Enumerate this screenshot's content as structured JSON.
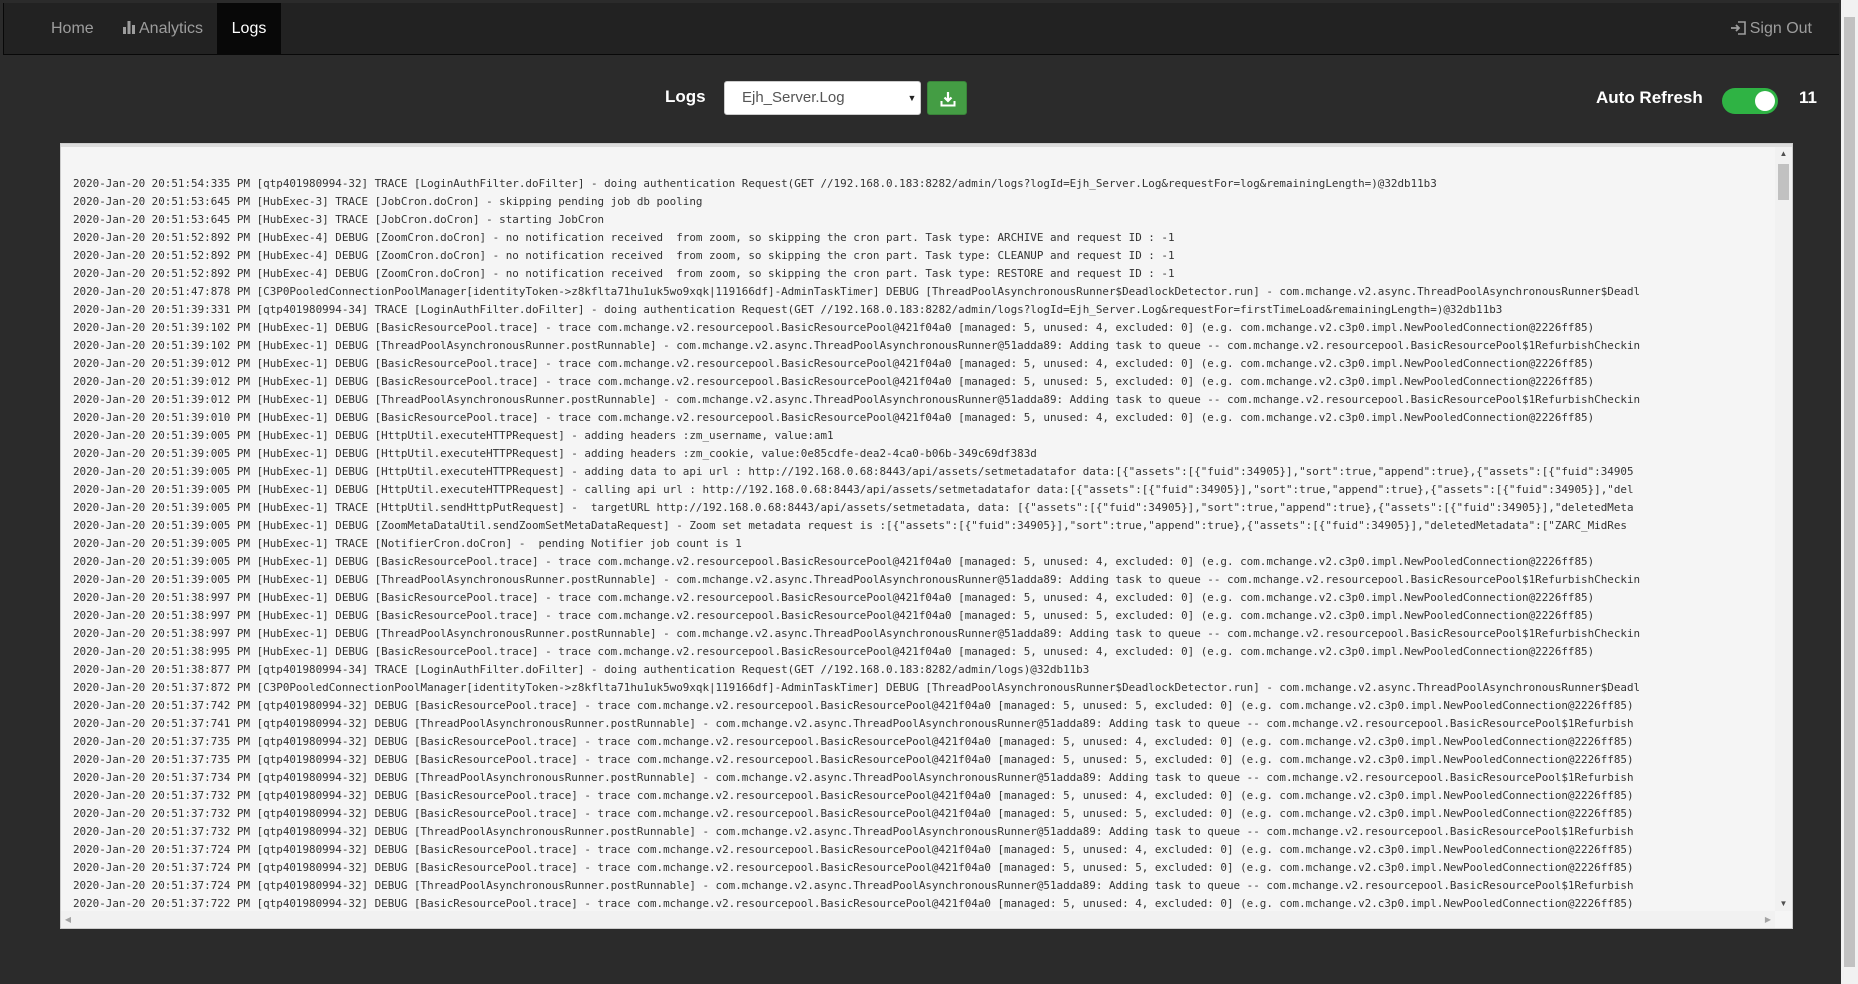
{
  "nav": {
    "home": "Home",
    "analytics": "Analytics",
    "logs": "Logs",
    "signout": "Sign Out"
  },
  "controls": {
    "logs_label": "Logs",
    "selected_log": "Ejh_Server.Log",
    "auto_refresh_label": "Auto Refresh",
    "auto_refresh_on": true,
    "refresh_count": "11"
  },
  "colors": {
    "navbar": "#222222",
    "active_tab": "#080808",
    "download": "#449d44",
    "toggle_on": "#2fb344"
  },
  "icons": {
    "analytics": "bar-chart-icon",
    "signout": "sign-out-icon",
    "download": "download-icon"
  },
  "log_lines": [
    "2020-Jan-20 20:51:54:335 PM [qtp401980994-32] TRACE [LoginAuthFilter.doFilter] - doing authentication Request(GET //192.168.0.183:8282/admin/logs?logId=Ejh_Server.Log&requestFor=log&remainingLength=)@32db11b3",
    "2020-Jan-20 20:51:53:645 PM [HubExec-3] TRACE [JobCron.doCron] - skipping pending job db pooling",
    "2020-Jan-20 20:51:53:645 PM [HubExec-3] TRACE [JobCron.doCron] - starting JobCron",
    "2020-Jan-20 20:51:52:892 PM [HubExec-4] DEBUG [ZoomCron.doCron] - no notification received  from zoom, so skipping the cron part. Task type: ARCHIVE and request ID : -1",
    "2020-Jan-20 20:51:52:892 PM [HubExec-4] DEBUG [ZoomCron.doCron] - no notification received  from zoom, so skipping the cron part. Task type: CLEANUP and request ID : -1",
    "2020-Jan-20 20:51:52:892 PM [HubExec-4] DEBUG [ZoomCron.doCron] - no notification received  from zoom, so skipping the cron part. Task type: RESTORE and request ID : -1",
    "2020-Jan-20 20:51:47:878 PM [C3P0PooledConnectionPoolManager[identityToken->z8kflta71hu1uk5wo9xqk|119166df]-AdminTaskTimer] DEBUG [ThreadPoolAsynchronousRunner$DeadlockDetector.run] - com.mchange.v2.async.ThreadPoolAsynchronousRunner$Deadl",
    "2020-Jan-20 20:51:39:331 PM [qtp401980994-34] TRACE [LoginAuthFilter.doFilter] - doing authentication Request(GET //192.168.0.183:8282/admin/logs?logId=Ejh_Server.Log&requestFor=firstTimeLoad&remainingLength=)@32db11b3",
    "2020-Jan-20 20:51:39:102 PM [HubExec-1] DEBUG [BasicResourcePool.trace] - trace com.mchange.v2.resourcepool.BasicResourcePool@421f04a0 [managed: 5, unused: 4, excluded: 0] (e.g. com.mchange.v2.c3p0.impl.NewPooledConnection@2226ff85)",
    "2020-Jan-20 20:51:39:102 PM [HubExec-1] DEBUG [ThreadPoolAsynchronousRunner.postRunnable] - com.mchange.v2.async.ThreadPoolAsynchronousRunner@51adda89: Adding task to queue -- com.mchange.v2.resourcepool.BasicResourcePool$1RefurbishCheckin",
    "2020-Jan-20 20:51:39:012 PM [HubExec-1] DEBUG [BasicResourcePool.trace] - trace com.mchange.v2.resourcepool.BasicResourcePool@421f04a0 [managed: 5, unused: 4, excluded: 0] (e.g. com.mchange.v2.c3p0.impl.NewPooledConnection@2226ff85)",
    "2020-Jan-20 20:51:39:012 PM [HubExec-1] DEBUG [BasicResourcePool.trace] - trace com.mchange.v2.resourcepool.BasicResourcePool@421f04a0 [managed: 5, unused: 5, excluded: 0] (e.g. com.mchange.v2.c3p0.impl.NewPooledConnection@2226ff85)",
    "2020-Jan-20 20:51:39:012 PM [HubExec-1] DEBUG [ThreadPoolAsynchronousRunner.postRunnable] - com.mchange.v2.async.ThreadPoolAsynchronousRunner@51adda89: Adding task to queue -- com.mchange.v2.resourcepool.BasicResourcePool$1RefurbishCheckin",
    "2020-Jan-20 20:51:39:010 PM [HubExec-1] DEBUG [BasicResourcePool.trace] - trace com.mchange.v2.resourcepool.BasicResourcePool@421f04a0 [managed: 5, unused: 4, excluded: 0] (e.g. com.mchange.v2.c3p0.impl.NewPooledConnection@2226ff85)",
    "2020-Jan-20 20:51:39:005 PM [HubExec-1] DEBUG [HttpUtil.executeHTTPRequest] - adding headers :zm_username, value:am1",
    "2020-Jan-20 20:51:39:005 PM [HubExec-1] DEBUG [HttpUtil.executeHTTPRequest] - adding headers :zm_cookie, value:0e85cdfe-dea2-4ca0-b06b-349c69df383d",
    "2020-Jan-20 20:51:39:005 PM [HubExec-1] DEBUG [HttpUtil.executeHTTPRequest] - adding data to api url : http://192.168.0.68:8443/api/assets/setmetadatafor data:[{\"assets\":[{\"fuid\":34905}],\"sort\":true,\"append\":true},{\"assets\":[{\"fuid\":34905",
    "2020-Jan-20 20:51:39:005 PM [HubExec-1] DEBUG [HttpUtil.executeHTTPRequest] - calling api url : http://192.168.0.68:8443/api/assets/setmetadatafor data:[{\"assets\":[{\"fuid\":34905}],\"sort\":true,\"append\":true},{\"assets\":[{\"fuid\":34905}],\"del",
    "2020-Jan-20 20:51:39:005 PM [HubExec-1] TRACE [HttpUtil.sendHttpPutRequest] -  targetURL http://192.168.0.68:8443/api/assets/setmetadata, data: [{\"assets\":[{\"fuid\":34905}],\"sort\":true,\"append\":true},{\"assets\":[{\"fuid\":34905}],\"deletedMeta",
    "2020-Jan-20 20:51:39:005 PM [HubExec-1] DEBUG [ZoomMetaDataUtil.sendZoomSetMetaDataRequest] - Zoom set metadata request is :[{\"assets\":[{\"fuid\":34905}],\"sort\":true,\"append\":true},{\"assets\":[{\"fuid\":34905}],\"deletedMetadata\":[\"ZARC_MidRes",
    "2020-Jan-20 20:51:39:005 PM [HubExec-1] TRACE [NotifierCron.doCron] -  pending Notifier job count is 1",
    "2020-Jan-20 20:51:39:005 PM [HubExec-1] DEBUG [BasicResourcePool.trace] - trace com.mchange.v2.resourcepool.BasicResourcePool@421f04a0 [managed: 5, unused: 4, excluded: 0] (e.g. com.mchange.v2.c3p0.impl.NewPooledConnection@2226ff85)",
    "2020-Jan-20 20:51:39:005 PM [HubExec-1] DEBUG [ThreadPoolAsynchronousRunner.postRunnable] - com.mchange.v2.async.ThreadPoolAsynchronousRunner@51adda89: Adding task to queue -- com.mchange.v2.resourcepool.BasicResourcePool$1RefurbishCheckin",
    "2020-Jan-20 20:51:38:997 PM [HubExec-1] DEBUG [BasicResourcePool.trace] - trace com.mchange.v2.resourcepool.BasicResourcePool@421f04a0 [managed: 5, unused: 4, excluded: 0] (e.g. com.mchange.v2.c3p0.impl.NewPooledConnection@2226ff85)",
    "2020-Jan-20 20:51:38:997 PM [HubExec-1] DEBUG [BasicResourcePool.trace] - trace com.mchange.v2.resourcepool.BasicResourcePool@421f04a0 [managed: 5, unused: 5, excluded: 0] (e.g. com.mchange.v2.c3p0.impl.NewPooledConnection@2226ff85)",
    "2020-Jan-20 20:51:38:997 PM [HubExec-1] DEBUG [ThreadPoolAsynchronousRunner.postRunnable] - com.mchange.v2.async.ThreadPoolAsynchronousRunner@51adda89: Adding task to queue -- com.mchange.v2.resourcepool.BasicResourcePool$1RefurbishCheckin",
    "2020-Jan-20 20:51:38:995 PM [HubExec-1] DEBUG [BasicResourcePool.trace] - trace com.mchange.v2.resourcepool.BasicResourcePool@421f04a0 [managed: 5, unused: 4, excluded: 0] (e.g. com.mchange.v2.c3p0.impl.NewPooledConnection@2226ff85)",
    "2020-Jan-20 20:51:38:877 PM [qtp401980994-34] TRACE [LoginAuthFilter.doFilter] - doing authentication Request(GET //192.168.0.183:8282/admin/logs)@32db11b3",
    "2020-Jan-20 20:51:37:872 PM [C3P0PooledConnectionPoolManager[identityToken->z8kflta71hu1uk5wo9xqk|119166df]-AdminTaskTimer] DEBUG [ThreadPoolAsynchronousRunner$DeadlockDetector.run] - com.mchange.v2.async.ThreadPoolAsynchronousRunner$Deadl",
    "2020-Jan-20 20:51:37:742 PM [qtp401980994-32] DEBUG [BasicResourcePool.trace] - trace com.mchange.v2.resourcepool.BasicResourcePool@421f04a0 [managed: 5, unused: 5, excluded: 0] (e.g. com.mchange.v2.c3p0.impl.NewPooledConnection@2226ff85)",
    "2020-Jan-20 20:51:37:741 PM [qtp401980994-32] DEBUG [ThreadPoolAsynchronousRunner.postRunnable] - com.mchange.v2.async.ThreadPoolAsynchronousRunner@51adda89: Adding task to queue -- com.mchange.v2.resourcepool.BasicResourcePool$1Refurbish",
    "2020-Jan-20 20:51:37:735 PM [qtp401980994-32] DEBUG [BasicResourcePool.trace] - trace com.mchange.v2.resourcepool.BasicResourcePool@421f04a0 [managed: 5, unused: 4, excluded: 0] (e.g. com.mchange.v2.c3p0.impl.NewPooledConnection@2226ff85)",
    "2020-Jan-20 20:51:37:735 PM [qtp401980994-32] DEBUG [BasicResourcePool.trace] - trace com.mchange.v2.resourcepool.BasicResourcePool@421f04a0 [managed: 5, unused: 5, excluded: 0] (e.g. com.mchange.v2.c3p0.impl.NewPooledConnection@2226ff85)",
    "2020-Jan-20 20:51:37:734 PM [qtp401980994-32] DEBUG [ThreadPoolAsynchronousRunner.postRunnable] - com.mchange.v2.async.ThreadPoolAsynchronousRunner@51adda89: Adding task to queue -- com.mchange.v2.resourcepool.BasicResourcePool$1Refurbish",
    "2020-Jan-20 20:51:37:732 PM [qtp401980994-32] DEBUG [BasicResourcePool.trace] - trace com.mchange.v2.resourcepool.BasicResourcePool@421f04a0 [managed: 5, unused: 4, excluded: 0] (e.g. com.mchange.v2.c3p0.impl.NewPooledConnection@2226ff85)",
    "2020-Jan-20 20:51:37:732 PM [qtp401980994-32] DEBUG [BasicResourcePool.trace] - trace com.mchange.v2.resourcepool.BasicResourcePool@421f04a0 [managed: 5, unused: 5, excluded: 0] (e.g. com.mchange.v2.c3p0.impl.NewPooledConnection@2226ff85)",
    "2020-Jan-20 20:51:37:732 PM [qtp401980994-32] DEBUG [ThreadPoolAsynchronousRunner.postRunnable] - com.mchange.v2.async.ThreadPoolAsynchronousRunner@51adda89: Adding task to queue -- com.mchange.v2.resourcepool.BasicResourcePool$1Refurbish",
    "2020-Jan-20 20:51:37:724 PM [qtp401980994-32] DEBUG [BasicResourcePool.trace] - trace com.mchange.v2.resourcepool.BasicResourcePool@421f04a0 [managed: 5, unused: 4, excluded: 0] (e.g. com.mchange.v2.c3p0.impl.NewPooledConnection@2226ff85)",
    "2020-Jan-20 20:51:37:724 PM [qtp401980994-32] DEBUG [BasicResourcePool.trace] - trace com.mchange.v2.resourcepool.BasicResourcePool@421f04a0 [managed: 5, unused: 5, excluded: 0] (e.g. com.mchange.v2.c3p0.impl.NewPooledConnection@2226ff85)",
    "2020-Jan-20 20:51:37:724 PM [qtp401980994-32] DEBUG [ThreadPoolAsynchronousRunner.postRunnable] - com.mchange.v2.async.ThreadPoolAsynchronousRunner@51adda89: Adding task to queue -- com.mchange.v2.resourcepool.BasicResourcePool$1Refurbish",
    "2020-Jan-20 20:51:37:722 PM [qtp401980994-32] DEBUG [BasicResourcePool.trace] - trace com.mchange.v2.resourcepool.BasicResourcePool@421f04a0 [managed: 5, unused: 4, excluded: 0] (e.g. com.mchange.v2.c3p0.impl.NewPooledConnection@2226ff85)"
  ]
}
